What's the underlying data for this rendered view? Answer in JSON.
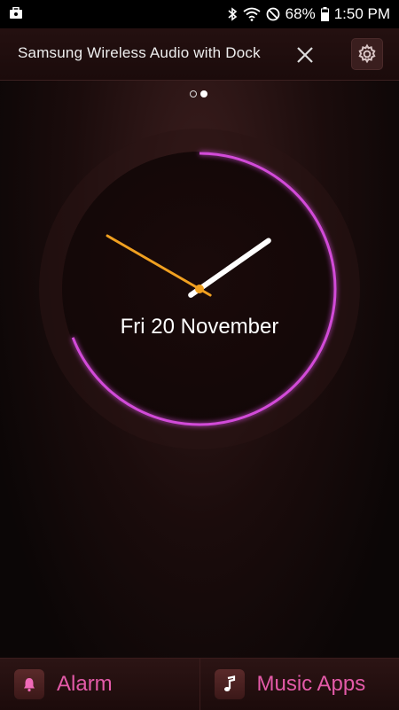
{
  "status_bar": {
    "battery_percent": "68%",
    "time": "1:50 PM",
    "icons": [
      "notification-briefcase-icon",
      "bluetooth-icon",
      "wifi-icon",
      "do-not-disturb-icon",
      "battery-icon"
    ]
  },
  "header": {
    "title": "Samsung Wireless Audio with Dock",
    "close_icon": "close-icon",
    "settings_icon": "gear-icon"
  },
  "pager": {
    "pages": 2,
    "active_index": 1
  },
  "clock": {
    "date": "Fri 20 November",
    "hour": 1,
    "minute": 50,
    "accent_color": "#d24bd8",
    "minute_hand_color": "#f0a020",
    "hour_hand_color": "#ffffff"
  },
  "bottom_bar": {
    "alarm_label": "Alarm",
    "alarm_icon": "bell-icon",
    "music_label": "Music Apps",
    "music_icon": "music-note-icon",
    "label_color": "#e35aa8"
  }
}
